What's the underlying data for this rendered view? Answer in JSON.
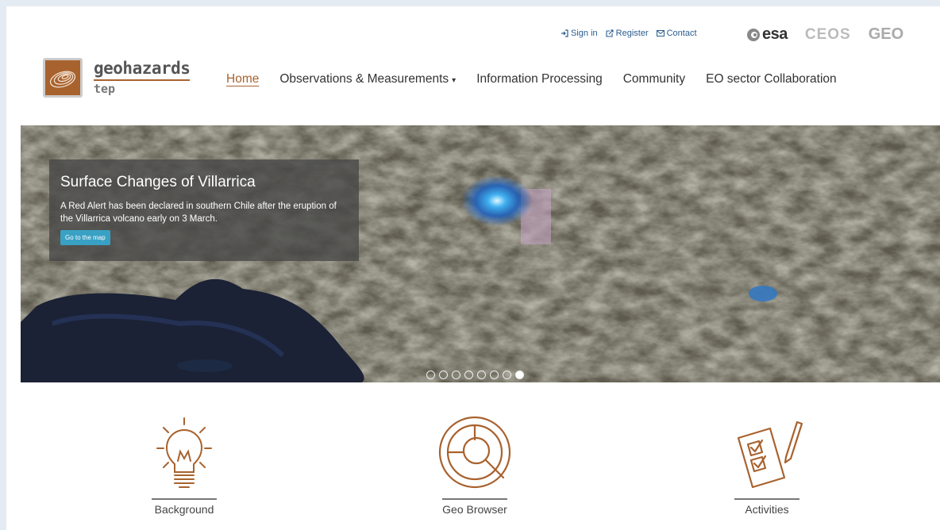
{
  "util_links": {
    "sign_in": "Sign in",
    "register": "Register",
    "contact": "Contact"
  },
  "partners": {
    "esa": "esa",
    "ceos": "CEOS",
    "geo": "GEO"
  },
  "logo": {
    "name": "geohazards",
    "sub": "tep"
  },
  "nav": {
    "home": "Home",
    "observations": "Observations & Measurements",
    "processing": "Information Processing",
    "community": "Community",
    "eo": "EO sector Collaboration"
  },
  "hero": {
    "title": "Surface Changes of Villarrica",
    "text": "A Red Alert has been declared in southern Chile after the eruption of the Villarrica volcano early on 3 March.",
    "button": "Go to the map",
    "slides": 8,
    "active_slide": 8
  },
  "features": {
    "background": "Background",
    "geo_browser": "Geo Browser",
    "activities": "Activities"
  },
  "colors": {
    "brand": "#a8622e",
    "button": "#39a1c4",
    "link": "#2a5d8f"
  }
}
